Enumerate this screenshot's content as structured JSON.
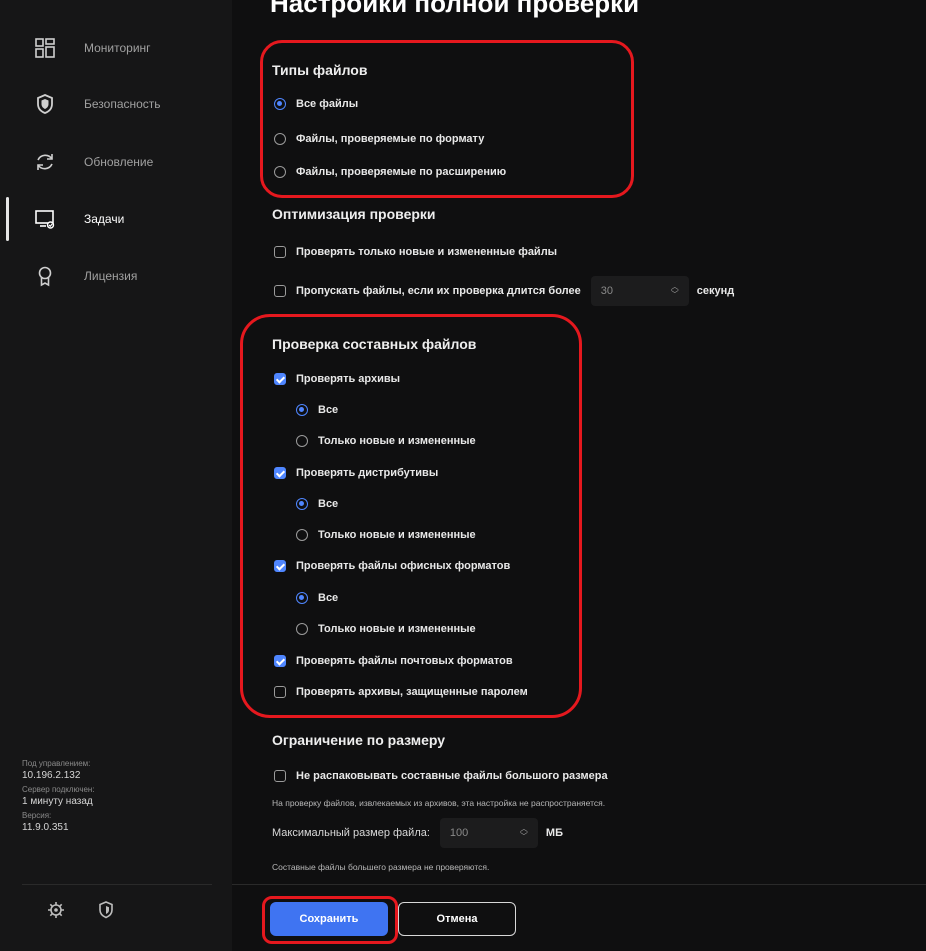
{
  "page_title": "Настройки полной проверки",
  "sidebar": {
    "items": [
      {
        "label": "Мониторинг",
        "icon": "dashboard-icon"
      },
      {
        "label": "Безопасность",
        "icon": "shield-icon"
      },
      {
        "label": "Обновление",
        "icon": "refresh-icon"
      },
      {
        "label": "Задачи",
        "icon": "tasks-icon",
        "active": true
      },
      {
        "label": "Лицензия",
        "icon": "license-icon"
      }
    ],
    "info": {
      "managed_label": "Под управлением:",
      "managed_value": "10.196.2.132",
      "server_label": "Сервер подключен:",
      "server_value": "1 минуту назад",
      "version_label": "Версия:",
      "version_value": "11.9.0.351"
    },
    "bottom_icons": [
      "gear-icon",
      "shield-small-icon"
    ]
  },
  "file_types": {
    "title": "Типы файлов",
    "options": [
      {
        "label": "Все файлы",
        "selected": true
      },
      {
        "label": "Файлы, проверяемые по формату",
        "selected": false
      },
      {
        "label": "Файлы, проверяемые по расширению",
        "selected": false
      }
    ]
  },
  "optimization": {
    "title": "Оптимизация проверки",
    "only_new_label": "Проверять только новые и измененные файлы",
    "only_new_checked": false,
    "skip_label": "Пропускать файлы, если их проверка длится более",
    "skip_checked": false,
    "skip_value": "30",
    "skip_unit": "секунд"
  },
  "compound": {
    "title": "Проверка составных файлов",
    "archives_label": "Проверять архивы",
    "archives_checked": true,
    "archives_all": "Все",
    "archives_new": "Только новые и измененные",
    "distr_label": "Проверять дистрибутивы",
    "distr_checked": true,
    "distr_all": "Все",
    "distr_new": "Только новые и измененные",
    "office_label": "Проверять файлы офисных форматов",
    "office_checked": true,
    "office_all": "Все",
    "office_new": "Только новые и измененные",
    "mail_label": "Проверять файлы почтовых форматов",
    "mail_checked": true,
    "protected_label": "Проверять архивы, защищенные паролем",
    "protected_checked": false
  },
  "size_limit": {
    "title": "Ограничение по размеру",
    "no_unpack_label": "Не распаковывать составные файлы большого размера",
    "no_unpack_checked": false,
    "note": "На проверку файлов, извлекаемых из архивов, эта настройка не распространяется.",
    "max_label": "Максимальный размер файла:",
    "max_value": "100",
    "max_unit": "МБ",
    "max_note": "Составные файлы большего размера не проверяются."
  },
  "buttons": {
    "save": "Сохранить",
    "cancel": "Отмена"
  },
  "colors": {
    "accent": "#3f74f2",
    "highlight": "#e5181e",
    "background": "#0f0f10",
    "sidebar": "#161617"
  }
}
